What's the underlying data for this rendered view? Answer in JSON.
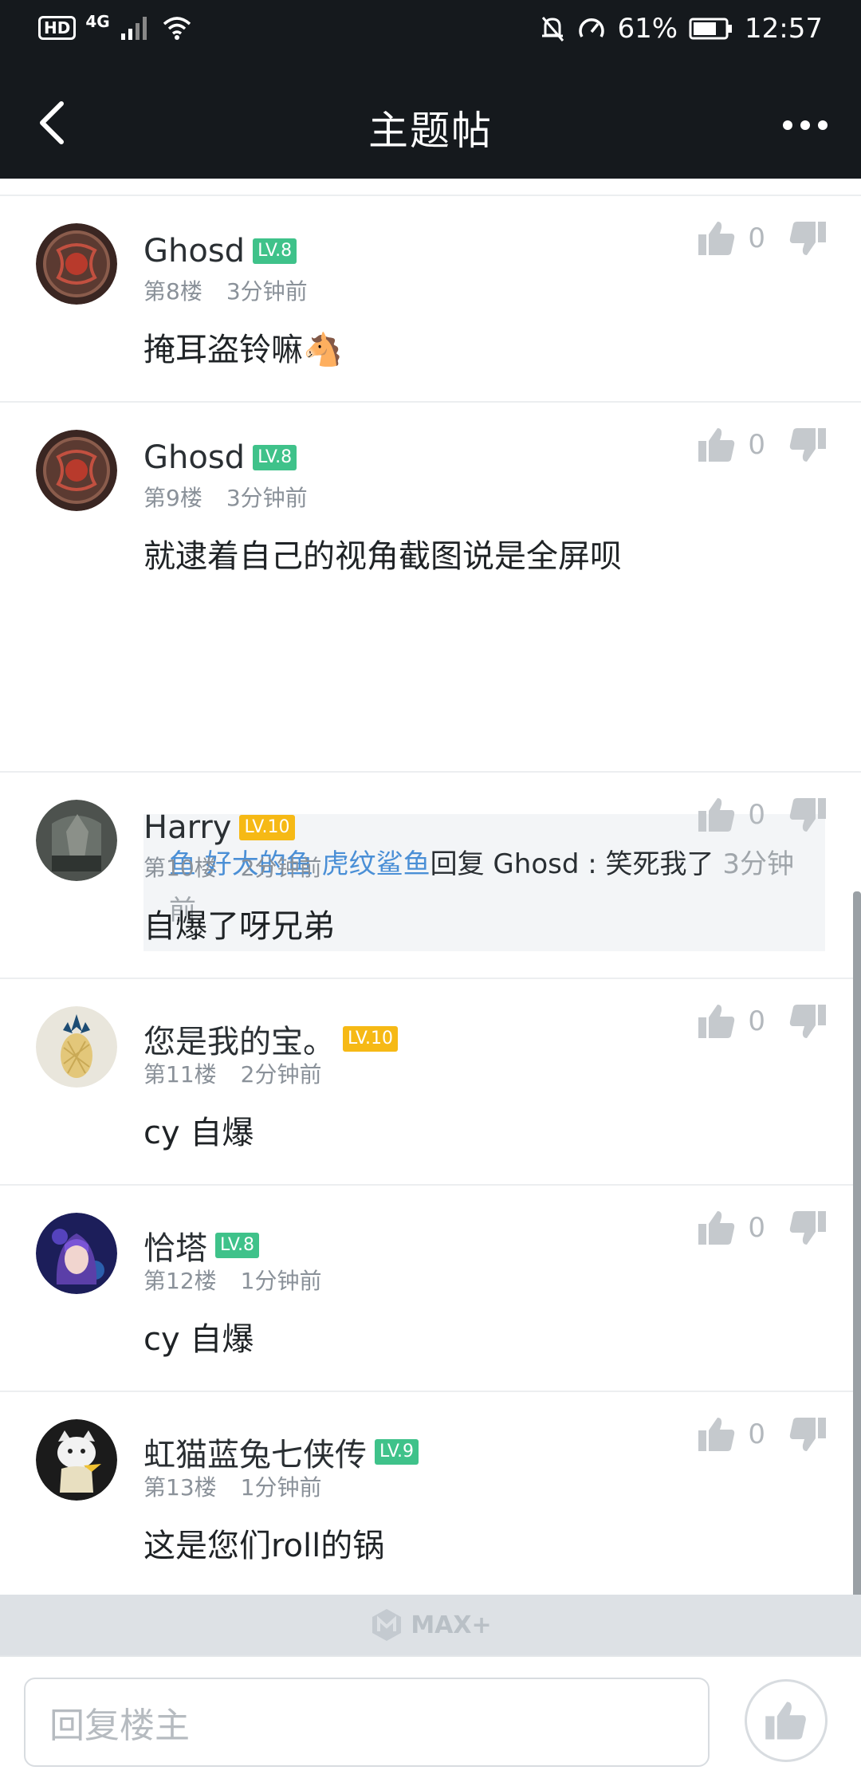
{
  "status_bar": {
    "hd": "HD",
    "network": "4G",
    "battery": "61%",
    "time": "12:57"
  },
  "header": {
    "title": "主题帖"
  },
  "comments": [
    {
      "username": "Ghosd",
      "level": "LV.8",
      "level_color": "#3fc28a",
      "floor": "第8楼",
      "time": "3分钟前",
      "content": "掩耳盗铃嘛🐴",
      "likes": "0",
      "avatar": "dota-shield-icon"
    },
    {
      "username": "Ghosd",
      "level": "LV.8",
      "level_color": "#3fc28a",
      "floor": "第9楼",
      "time": "3分钟前",
      "content": "就逮着自己的视角截图说是全屏呗",
      "likes": "0",
      "avatar": "dota-shield-icon",
      "reply": {
        "users": "鱼 好大的鱼 虎纹鲨鱼",
        "text": "回复 Ghosd : 笑死我了",
        "time": "3分钟前"
      }
    },
    {
      "username": "Harry",
      "level": "LV.10",
      "level_color": "#f6b915",
      "floor": "第10楼",
      "time": "2分钟前",
      "content": "自爆了呀兄弟",
      "likes": "0",
      "avatar": "harry-avatar"
    },
    {
      "username": "您是我的宝。",
      "level": "LV.10",
      "level_color": "#f6b915",
      "floor": "第11楼",
      "time": "2分钟前",
      "content": "cy 自爆",
      "likes": "0",
      "avatar": "pineapple-avatar"
    },
    {
      "username": "恰塔",
      "level": "LV.8",
      "level_color": "#3fc28a",
      "floor": "第12楼",
      "time": "1分钟前",
      "content": "cy 自爆",
      "likes": "0",
      "avatar": "anime-girl-avatar"
    },
    {
      "username": "虹猫蓝兔七侠传",
      "level": "LV.9",
      "level_color": "#3fc28a",
      "floor": "第13楼",
      "time": "1分钟前",
      "content": "这是您们roll的锅",
      "likes": "0",
      "avatar": "cartoon-cat-avatar"
    }
  ],
  "footer": {
    "logo_text": "MAX+"
  },
  "reply_bar": {
    "placeholder": "回复楼主"
  }
}
